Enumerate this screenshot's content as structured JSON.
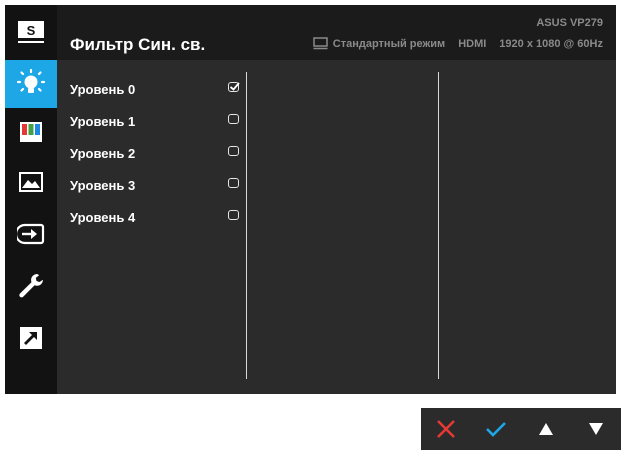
{
  "header": {
    "title": "Фильтр Син. св.",
    "model": "ASUS VP279",
    "mode": "Стандартный режим",
    "input": "HDMI",
    "resolution": "1920 x 1080 @ 60Hz"
  },
  "sidebar": {
    "items": [
      {
        "name": "splendid",
        "label": "S",
        "active": false
      },
      {
        "name": "blue-light-filter",
        "active": true
      },
      {
        "name": "color",
        "active": false
      },
      {
        "name": "image",
        "active": false
      },
      {
        "name": "input-select",
        "active": false
      },
      {
        "name": "system-setup",
        "active": false
      },
      {
        "name": "shortcut",
        "active": false
      }
    ]
  },
  "levels": [
    {
      "label": "Уровень 0",
      "checked": true
    },
    {
      "label": "Уровень 1",
      "checked": false
    },
    {
      "label": "Уровень 2",
      "checked": false
    },
    {
      "label": "Уровень 3",
      "checked": false
    },
    {
      "label": "Уровень 4",
      "checked": false
    }
  ],
  "controls": [
    "close-icon",
    "confirm-icon",
    "up-arrow-icon",
    "down-arrow-icon"
  ],
  "colors": {
    "accent": "#1ea7e6",
    "close": "#e53935",
    "confirm": "#1ea7e6",
    "background": "#2b2b2b",
    "sidebar": "#121212"
  }
}
